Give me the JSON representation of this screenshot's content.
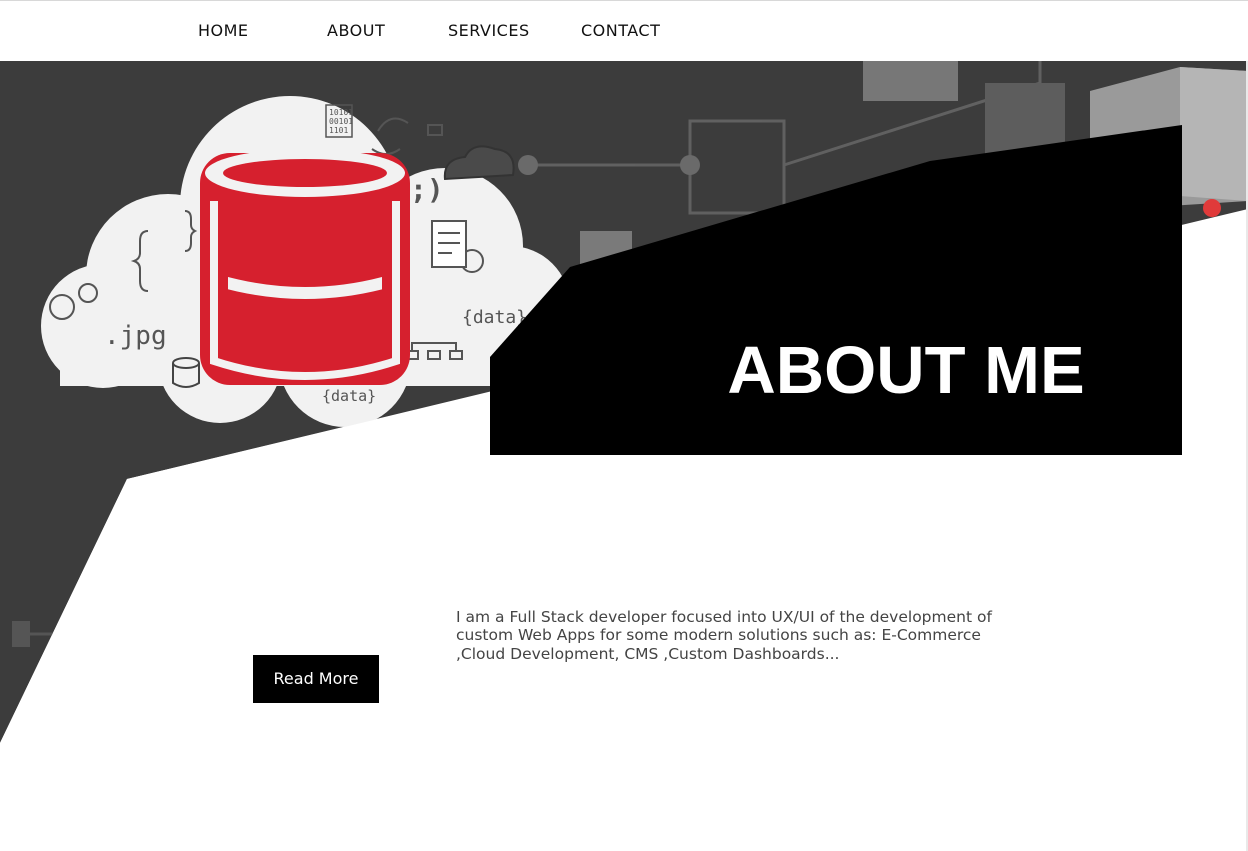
{
  "nav": {
    "items": [
      {
        "label": "HOME"
      },
      {
        "label": "ABOUT"
      },
      {
        "label": "SERVICES"
      },
      {
        "label": "CONTACT"
      }
    ]
  },
  "hero": {
    "title": "ABOUT ME",
    "cloud_labels": {
      "jpg": ".jpg",
      "data1": "{data}",
      "data2": "{data}",
      "binary": "10101\n00101\n1101",
      "wink": ";)"
    }
  },
  "about": {
    "text": "I am a Full Stack developer focused into UX/UI of the development of custom Web Apps for some modern solutions such as: E-Commerce ,Cloud Development, CMS ,Custom Dashboards...",
    "button_label": "Read More"
  },
  "colors": {
    "accent_red": "#d6202e",
    "dark_bg": "#3b3b3b",
    "banner_black": "#000000",
    "red_dot": "#e03a3a"
  }
}
